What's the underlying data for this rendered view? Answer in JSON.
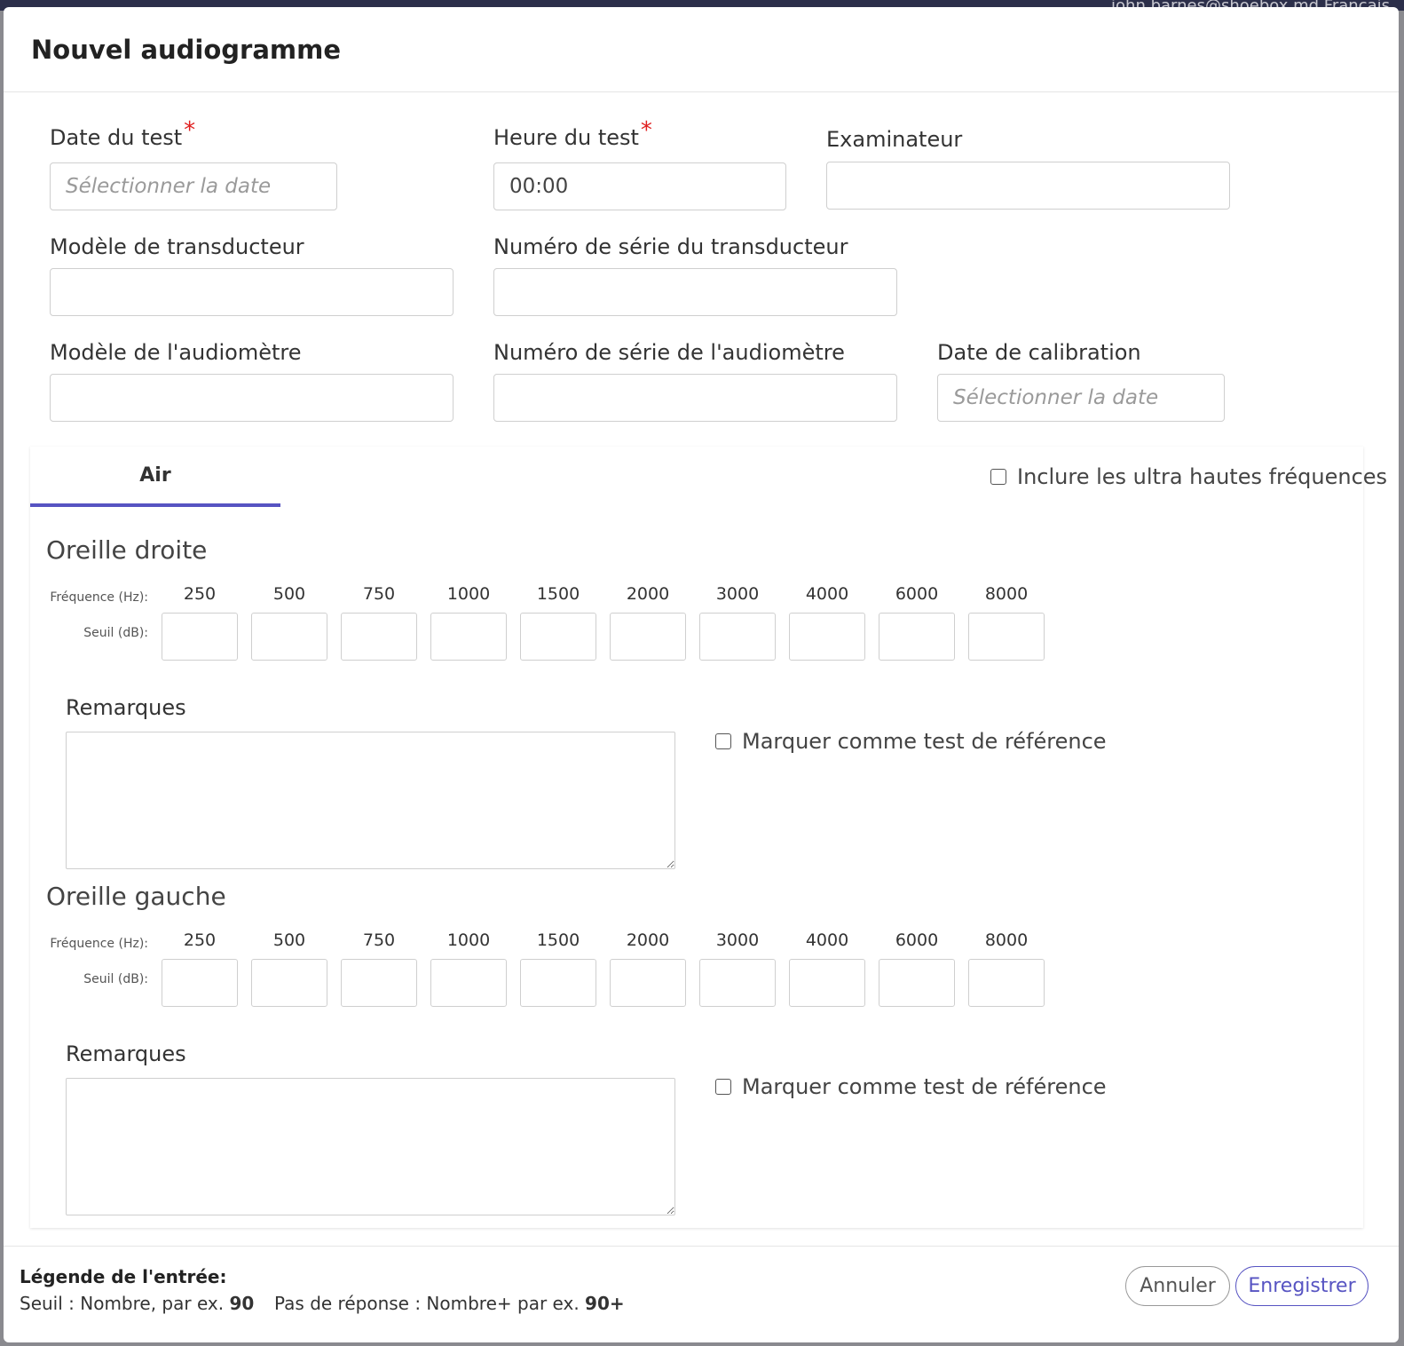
{
  "backdrop": {
    "user_text": "john.barnes@shoebox.md   Français"
  },
  "modal": {
    "title": "Nouvel audiogramme"
  },
  "fields": {
    "test_date": {
      "label": "Date du test",
      "required_mark": "*",
      "placeholder": "Sélectionner la date"
    },
    "test_time": {
      "label": "Heure du test",
      "required_mark": "*",
      "value": "00:00"
    },
    "examiner": {
      "label": "Examinateur",
      "value": ""
    },
    "transducer_model": {
      "label": "Modèle de transducteur",
      "value": ""
    },
    "transducer_serial": {
      "label": "Numéro de série du transducteur",
      "value": ""
    },
    "audiometer_model": {
      "label": "Modèle de l'audiomètre",
      "value": ""
    },
    "audiometer_serial": {
      "label": "Numéro de série de l'audiomètre",
      "value": ""
    },
    "calibration_date": {
      "label": "Date de calibration",
      "placeholder": "Sélectionner la date"
    }
  },
  "tabs": [
    {
      "label": "Air",
      "active": true
    }
  ],
  "ultra_high": {
    "label": "Inclure les ultra hautes fréquences",
    "checked": false
  },
  "grid": {
    "freq_label": "Fréquence (Hz):",
    "threshold_label": "Seuil (dB):",
    "frequencies": [
      "250",
      "500",
      "750",
      "1000",
      "1500",
      "2000",
      "3000",
      "4000",
      "6000",
      "8000"
    ]
  },
  "right_ear": {
    "title": "Oreille droite",
    "remarks_label": "Remarques",
    "reference_label": "Marquer comme test de référence"
  },
  "left_ear": {
    "title": "Oreille gauche",
    "remarks_label": "Remarques",
    "reference_label": "Marquer comme test de référence"
  },
  "footer": {
    "legend_title": "Légende de l'entrée:",
    "threshold_text": "Seuil : Nombre, par ex. ",
    "threshold_example": "90",
    "no_response_text": "Pas de réponse : Nombre+ par ex. ",
    "no_response_example": "90+",
    "cancel_label": "Annuler",
    "save_label": "Enregistrer"
  },
  "colors": {
    "accent": "#5754c2",
    "required": "#e02020",
    "border": "#cfcfcf"
  }
}
